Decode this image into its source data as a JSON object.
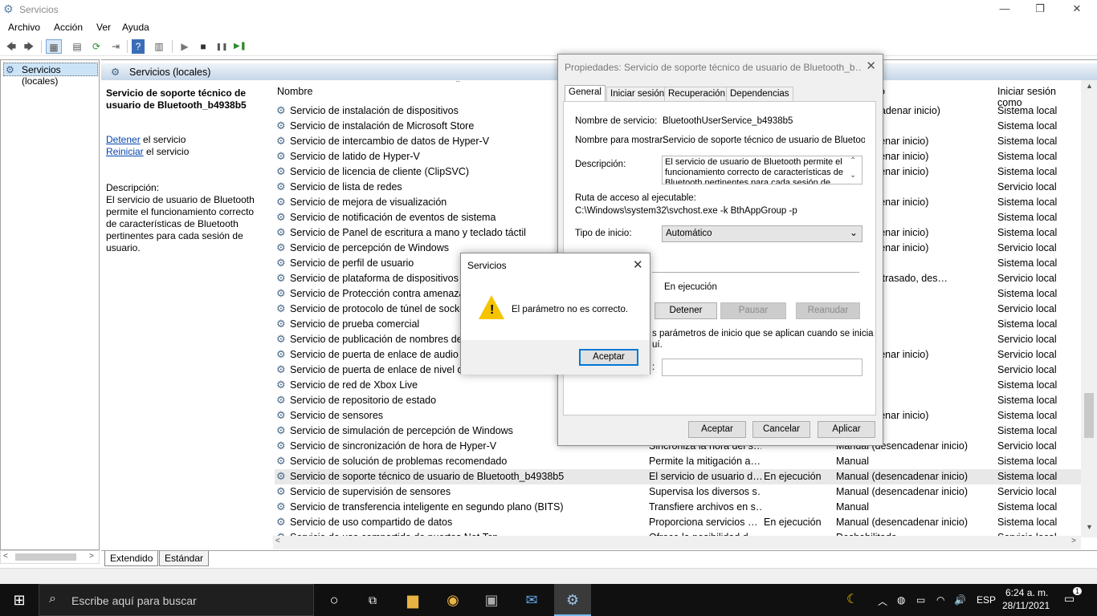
{
  "window": {
    "title": "Servicios",
    "minimize": "—",
    "restore": "❐",
    "close": "✕"
  },
  "menu": {
    "archivo": "Archivo",
    "accion": "Acción",
    "ver": "Ver",
    "ayuda": "Ayuda"
  },
  "toolbar": {
    "back": "🡄",
    "forward": "🡆",
    "play": "▶",
    "stop": "■",
    "pause": "❚❚",
    "restart": "▶❚"
  },
  "tree": {
    "node": "Servicios (locales)"
  },
  "panel": {
    "header": "Servicios (locales)",
    "service_title": "Servicio de soporte técnico de usuario de Bluetooth_b4938b5",
    "stop_link": "Detener",
    "stop_suffix": " el servicio",
    "restart_link": "Reiniciar",
    "restart_suffix": " el servicio",
    "desc_label": "Descripción:",
    "desc_text": "El servicio de usuario de Bluetooth permite el funcionamiento correcto de características de Bluetooth pertinentes para cada sesión de usuario."
  },
  "columns": {
    "name": "Nombre",
    "type_partial": "o",
    "logon": "Iniciar sesión como"
  },
  "rows": [
    {
      "name": "Servicio de instalación de dispositivos",
      "desc": "",
      "status": "",
      "type": "o (desencadenar inicio)",
      "logon": "Sistema local"
    },
    {
      "name": "Servicio de instalación de Microsoft Store",
      "desc": "",
      "status": "",
      "type": "",
      "logon": "Sistema local"
    },
    {
      "name": "Servicio de intercambio de datos de Hyper-V",
      "desc": "",
      "status": "",
      "type": "desencadenar inicio)",
      "logon": "Sistema local"
    },
    {
      "name": "Servicio de latido de Hyper-V",
      "desc": "",
      "status": "",
      "type": "desencadenar inicio)",
      "logon": "Sistema local"
    },
    {
      "name": "Servicio de licencia de cliente (ClipSVC)",
      "desc": "",
      "status": "",
      "type": "desencadenar inicio)",
      "logon": "Sistema local"
    },
    {
      "name": "Servicio de lista de redes",
      "desc": "",
      "status": "",
      "type": "",
      "logon": "Servicio local"
    },
    {
      "name": "Servicio de mejora de visualización",
      "desc": "",
      "status": "",
      "type": "desencadenar inicio)",
      "logon": "Sistema local"
    },
    {
      "name": "Servicio de notificación de eventos de sistema",
      "desc": "",
      "status": "",
      "type": "o",
      "logon": "Sistema local"
    },
    {
      "name": "Servicio de Panel de escritura a mano y teclado táctil",
      "desc": "",
      "status": "",
      "type": "desencadenar inicio)",
      "logon": "Sistema local"
    },
    {
      "name": "Servicio de percepción de Windows",
      "desc": "",
      "status": "",
      "type": "desencadenar inicio)",
      "logon": "Servicio local"
    },
    {
      "name": "Servicio de perfil de usuario",
      "desc": "",
      "status": "",
      "type": "o",
      "logon": "Sistema local"
    },
    {
      "name": "Servicio de plataforma de dispositivos co",
      "desc": "",
      "status": "",
      "type": "o (inicio retrasado, des…",
      "logon": "Servicio local"
    },
    {
      "name": "Servicio de Protección contra amenazas",
      "desc": "",
      "status": "",
      "type": "",
      "logon": "Sistema local"
    },
    {
      "name": "Servicio de protocolo de túnel de sockets",
      "desc": "",
      "status": "",
      "type": "",
      "logon": "Servicio local"
    },
    {
      "name": "Servicio de prueba comercial",
      "desc": "",
      "status": "",
      "type": "",
      "logon": "Sistema local"
    },
    {
      "name": "Servicio de publicación de nombres de e",
      "desc": "",
      "status": "",
      "type": "",
      "logon": "Servicio local"
    },
    {
      "name": "Servicio de puerta de enlace de audio de",
      "desc": "",
      "status": "",
      "type": "desencadenar inicio)",
      "logon": "Servicio local"
    },
    {
      "name": "Servicio de puerta de enlace de nivel de a",
      "desc": "",
      "status": "",
      "type": "",
      "logon": "Servicio local"
    },
    {
      "name": "Servicio de red de Xbox Live",
      "desc": "",
      "status": "",
      "type": "",
      "logon": "Sistema local"
    },
    {
      "name": "Servicio de repositorio de estado",
      "desc": "",
      "status": "",
      "type": "",
      "logon": "Sistema local"
    },
    {
      "name": "Servicio de sensores",
      "desc": "",
      "status": "",
      "type": "desencadenar inicio)",
      "logon": "Sistema local"
    },
    {
      "name": "Servicio de simulación de percepción de Windows",
      "desc": "",
      "status": "",
      "type": "",
      "logon": "Sistema local"
    },
    {
      "name": "Servicio de sincronización de hora de Hyper-V",
      "desc": "Sincroniza la hora del s…",
      "status": "",
      "type": "Manual (desencadenar inicio)",
      "logon": "Servicio local"
    },
    {
      "name": "Servicio de solución de problemas recomendado",
      "desc": "Permite la mitigación a…",
      "status": "",
      "type": "Manual",
      "logon": "Sistema local"
    },
    {
      "name": "Servicio de soporte técnico de usuario de Bluetooth_b4938b5",
      "desc": "El servicio de usuario d…",
      "status": "En ejecución",
      "type": "Manual (desencadenar inicio)",
      "logon": "Sistema local"
    },
    {
      "name": "Servicio de supervisión de sensores",
      "desc": "Supervisa los diversos s…",
      "status": "",
      "type": "Manual (desencadenar inicio)",
      "logon": "Servicio local"
    },
    {
      "name": "Servicio de transferencia inteligente en segundo plano (BITS)",
      "desc": "Transfiere archivos en s…",
      "status": "",
      "type": "Manual",
      "logon": "Sistema local"
    },
    {
      "name": "Servicio de uso compartido de datos",
      "desc": "Proporciona servicios …",
      "status": "En ejecución",
      "type": "Manual (desencadenar inicio)",
      "logon": "Sistema local"
    },
    {
      "name": "Servicio de uso compartido de puertos Net.Tcp",
      "desc": "Ofrece la posibilidad d…",
      "status": "",
      "type": "Deshabilitado",
      "logon": "Servicio local"
    }
  ],
  "bottom_tabs": {
    "extended": "Extendido",
    "standard": "Estándar"
  },
  "props": {
    "title": "Propiedades: Servicio de soporte técnico de usuario de Bluetooth_b…",
    "tabs": [
      "General",
      "Iniciar sesión",
      "Recuperación",
      "Dependencias"
    ],
    "service_name_label": "Nombre de servicio:",
    "service_name": "BluetoothUserService_b4938b5",
    "display_name_label": "Nombre para mostrar:",
    "display_name": "Servicio de soporte técnico de usuario de Bluetooth_",
    "description_label": "Descripción:",
    "description": "El servicio de usuario de Bluetooth permite el funcionamiento correcto de características de Bluetooth pertinentes para cada sesión de",
    "path_label": "Ruta de acceso al ejecutable:",
    "path": "C:\\Windows\\system32\\svchost.exe -k BthAppGroup -p",
    "startup_label": "Tipo de inicio:",
    "startup_value": "Automático",
    "status_value": "En ejecución",
    "stop_btn": "Detener",
    "pause_btn": "Pausar",
    "resume_btn": "Reanudar",
    "params_text_1": "s parámetros de inicio que se aplican cuando se inicia",
    "params_text_2": "uí.",
    "params_label_partial": ":",
    "ok": "Aceptar",
    "cancel": "Cancelar",
    "apply": "Aplicar"
  },
  "msgbox": {
    "title": "Servicios",
    "text": "El parámetro no es correcto.",
    "ok": "Aceptar",
    "warning_glyph": "!"
  },
  "taskbar": {
    "search_placeholder": "Escribe aquí para buscar",
    "lang": "ESP",
    "time": "6:24 a. m.",
    "date": "28/11/2021",
    "notifications": "1"
  },
  "colors": {
    "accent": "#0078d7",
    "selection": "#cce4f7",
    "warning": "#f5c400"
  }
}
